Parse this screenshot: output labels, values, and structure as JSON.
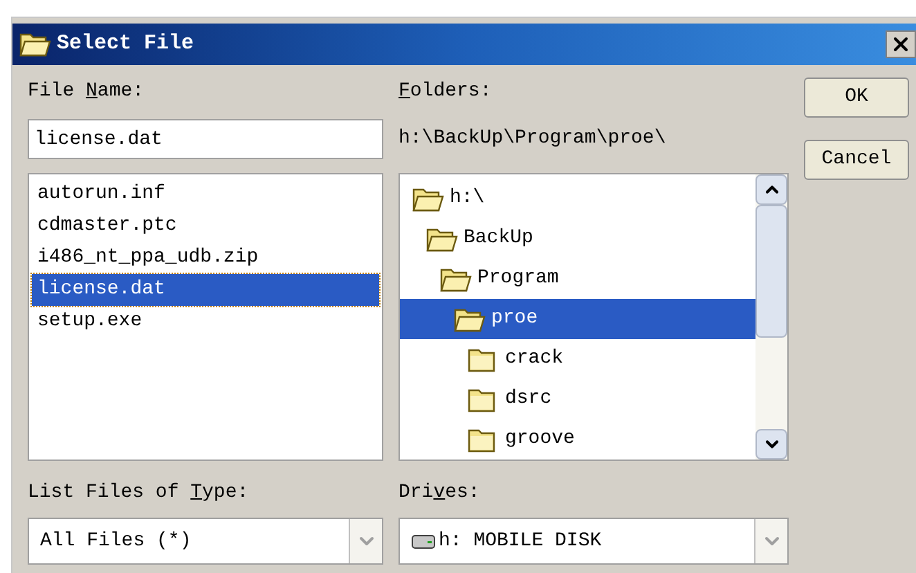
{
  "window": {
    "title": "Select File"
  },
  "file_name": {
    "label": {
      "before": "File ",
      "key": "N",
      "after": "ame:"
    },
    "value": "license.dat"
  },
  "files": [
    {
      "name": "autorun.inf",
      "selected": false
    },
    {
      "name": "cdmaster.ptc",
      "selected": false
    },
    {
      "name": "i486_nt_ppa_udb.zip",
      "selected": false
    },
    {
      "name": "license.dat",
      "selected": true
    },
    {
      "name": "setup.exe",
      "selected": false
    }
  ],
  "folders": {
    "label": {
      "key": "F",
      "after": "olders:"
    },
    "path": "h:\\BackUp\\Program\\proe\\",
    "tree": [
      {
        "name": "h:\\",
        "expanded": true,
        "selected": false,
        "children": [
          {
            "name": "BackUp",
            "expanded": true,
            "selected": false,
            "children": [
              {
                "name": "Program",
                "expanded": true,
                "selected": false,
                "children": [
                  {
                    "name": "proe",
                    "expanded": true,
                    "selected": true,
                    "children": [
                      {
                        "name": "crack",
                        "expanded": false,
                        "selected": false
                      },
                      {
                        "name": "dsrc",
                        "expanded": false,
                        "selected": false
                      },
                      {
                        "name": "groove",
                        "expanded": false,
                        "selected": false
                      }
                    ]
                  }
                ]
              }
            ]
          }
        ]
      }
    ]
  },
  "buttons": [
    "OK",
    "Cancel"
  ],
  "file_type": {
    "label": {
      "before": "List Files of ",
      "key": "T",
      "after": "ype:"
    },
    "value": "All Files (*)"
  },
  "drives": {
    "label": {
      "before": "Dri",
      "key": "v",
      "after": "es:"
    },
    "value": "h: MOBILE DISK"
  }
}
